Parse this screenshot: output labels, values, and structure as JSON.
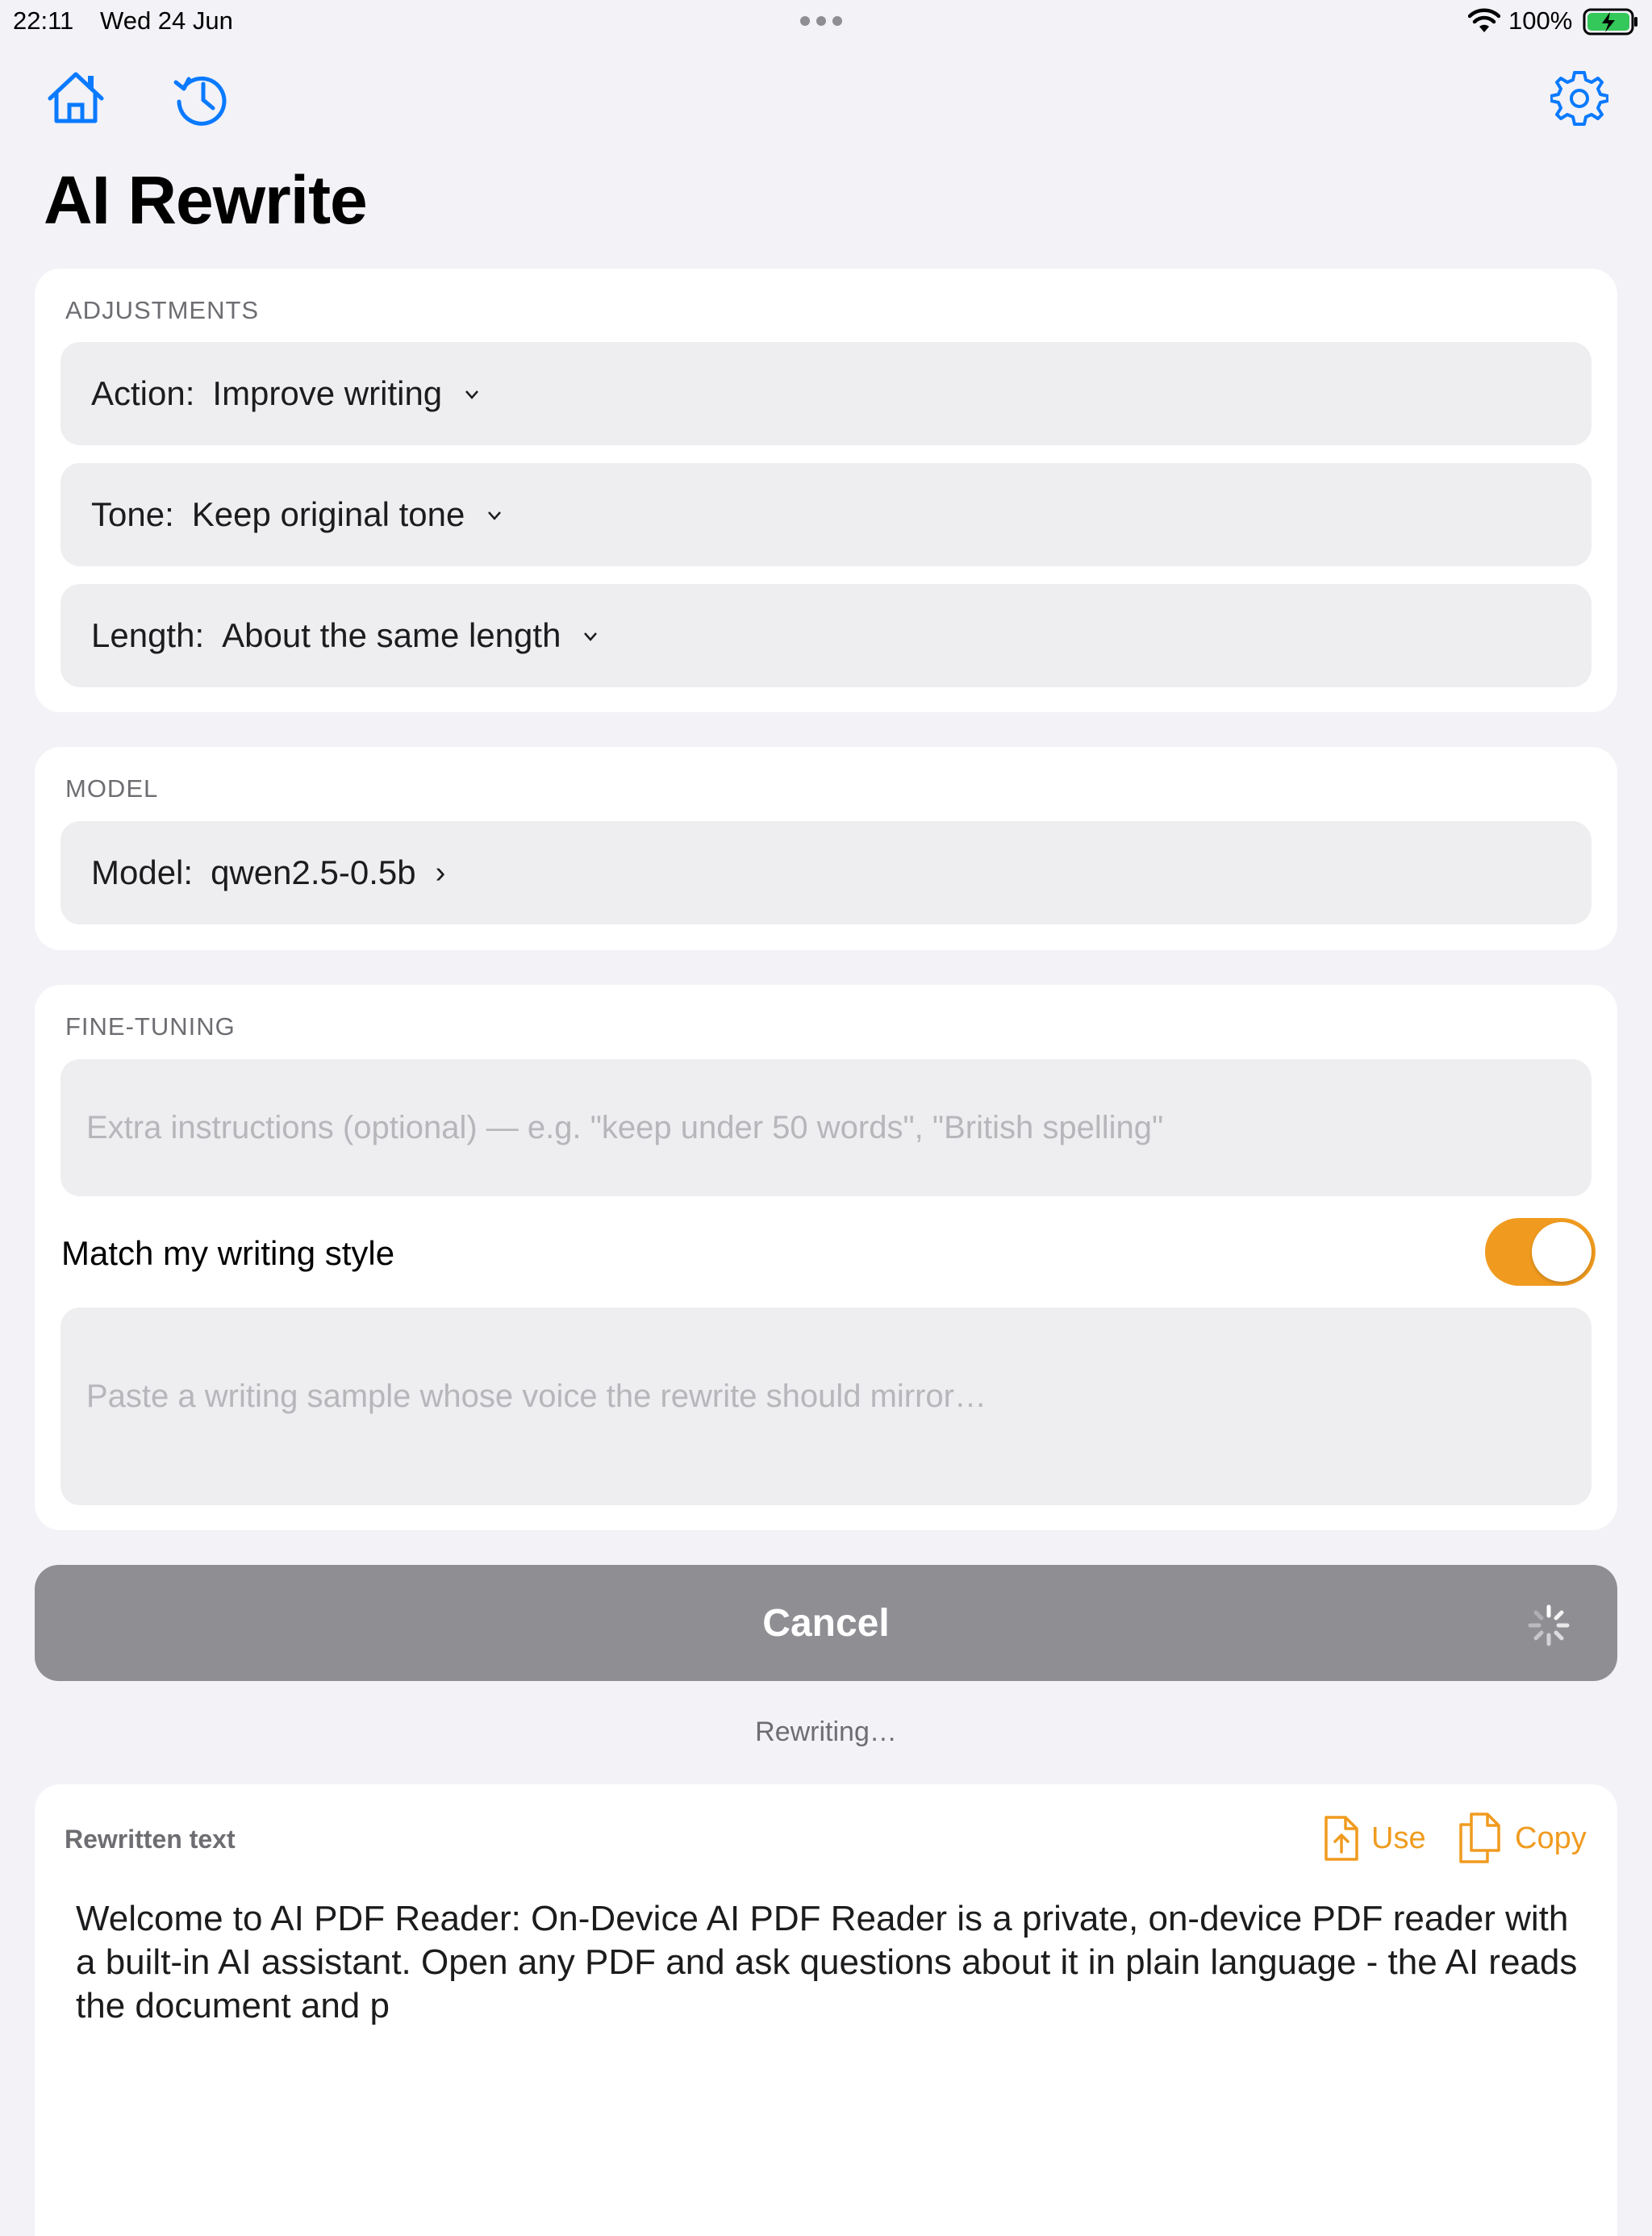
{
  "status_bar": {
    "time": "22:11",
    "date": "Wed 24 Jun",
    "battery_percent": "100%"
  },
  "toolbar": {
    "home_icon": "home-icon",
    "history_icon": "history-icon",
    "settings_icon": "gear-icon",
    "accent_color": "#0a7aff"
  },
  "page": {
    "title": "AI Rewrite"
  },
  "adjustments": {
    "section_label": "ADJUSTMENTS",
    "action": {
      "label": "Action:",
      "value": "Improve writing"
    },
    "tone": {
      "label": "Tone:",
      "value": "Keep original tone"
    },
    "length": {
      "label": "Length:",
      "value": "About the same length"
    }
  },
  "model": {
    "section_label": "MODEL",
    "label": "Model:",
    "value": "qwen2.5-0.5b"
  },
  "fine_tuning": {
    "section_label": "FINE-TUNING",
    "extra_instructions_placeholder": "Extra instructions (optional) — e.g. \"keep under 50 words\", \"British spelling\"",
    "match_style_label": "Match my writing style",
    "match_style_enabled": true,
    "writing_sample_placeholder": "Paste a writing sample whose voice the rewrite should mirror…",
    "toggle_color": "#f09b1f"
  },
  "action_button": {
    "label": "Cancel"
  },
  "progress_status": "Rewriting…",
  "result": {
    "title": "Rewritten text",
    "use_label": "Use",
    "copy_label": "Copy",
    "text": "Welcome to AI PDF Reader: On-Device AI PDF Reader is a private, on-device PDF reader with a built-in AI assistant. Open any PDF and ask questions about it in plain language - the AI reads the document and p"
  }
}
